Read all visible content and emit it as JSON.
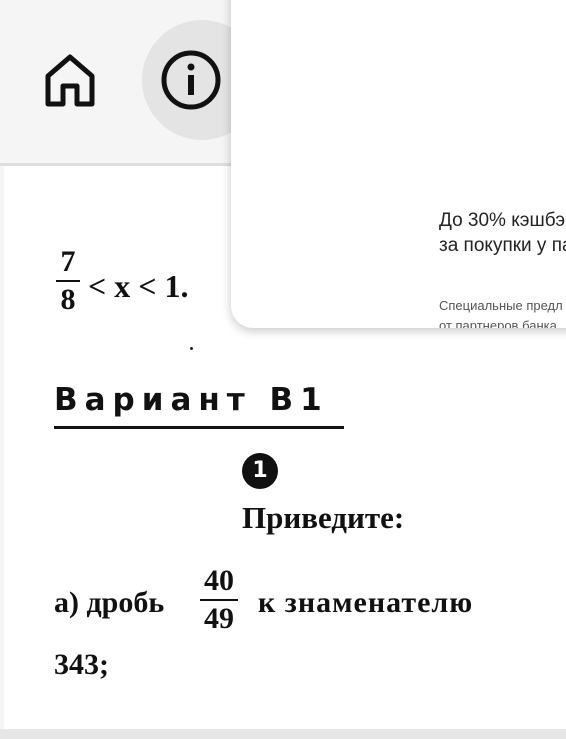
{
  "toolbar": {
    "home_icon": "home-icon",
    "info_icon": "info-icon"
  },
  "document": {
    "inequality": {
      "numerator": "7",
      "denominator": "8",
      "rest": "< x < 1."
    },
    "variant_title": "Вариант В1",
    "task_number": "1",
    "task_title": "Приведите:",
    "item_a_prefix": "а) дробь",
    "item_a_numerator": "40",
    "item_a_denominator": "49",
    "item_a_suffix": "к знаменателю",
    "item_a_continuation": "343;"
  },
  "popup": {
    "title_line1": "До 30% кэшбэ",
    "title_line2": "за покупки у па",
    "sub_line1": "Специальные предл",
    "sub_line2": "от партнеров банка"
  },
  "colors": {
    "toolbar_bg": "#f5f5f5",
    "info_button_bg": "#e4e4e4",
    "page_bg": "#ffffff",
    "text": "#111111"
  }
}
